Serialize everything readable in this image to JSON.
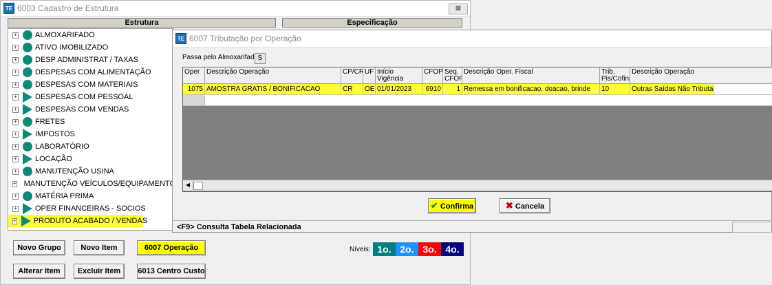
{
  "main_window": {
    "title": "6003 Cadastro de Estrutura",
    "close_label": "⊠",
    "headers": {
      "estrutura": "Estrutura",
      "especificacao": "Especificação"
    },
    "tree_items": [
      {
        "label": "ALMOXARIFADO",
        "icon": "circle"
      },
      {
        "label": "ATIVO IMOBILIZADO",
        "icon": "circle"
      },
      {
        "label": "DESP ADMINISTRAT / TAXAS",
        "icon": "circle"
      },
      {
        "label": "DESPESAS COM ALIMENTAÇÃO",
        "icon": "circle"
      },
      {
        "label": "DESPESAS COM MATERIAIS",
        "icon": "circle"
      },
      {
        "label": "DESPESAS COM PESSOAL",
        "icon": "triangle"
      },
      {
        "label": "DESPESAS COM VENDAS",
        "icon": "triangle"
      },
      {
        "label": "FRETES",
        "icon": "circle"
      },
      {
        "label": "IMPOSTOS",
        "icon": "triangle"
      },
      {
        "label": "LABORATÓRIO",
        "icon": "circle"
      },
      {
        "label": "LOCAÇÃO",
        "icon": "triangle"
      },
      {
        "label": "MANUTENÇÃO USINA",
        "icon": "circle"
      },
      {
        "label": "MANUTENÇÃO VEÍCULOS/EQUIPAMENTOS",
        "icon": "circle"
      },
      {
        "label": "MATÉRIA PRIMA",
        "icon": "circle"
      },
      {
        "label": "OPER FINANCEIRAS - SOCIOS",
        "icon": "triangle"
      },
      {
        "label": "PRODUTO ACABADO / VENDAS",
        "icon": "triangle"
      }
    ],
    "buttons": {
      "novo_grupo": "Novo Grupo",
      "novo_item": "Novo Item",
      "operacao": "6007 Operação",
      "alterar_item": "Alterar Item",
      "excluir_item": "Excluir Item",
      "centro_custo": "6013 Centro Custo"
    },
    "niveis": {
      "label": "Níveis:",
      "levels": [
        {
          "label": "1o.",
          "color": "#008080"
        },
        {
          "label": "2o.",
          "color": "#1e90ff"
        },
        {
          "label": "3o.",
          "color": "#ff0000"
        },
        {
          "label": "4o.",
          "color": "#000080"
        }
      ]
    }
  },
  "dialog": {
    "title": "6007 Tributação por Operação",
    "passa_label": "Passa pelo Almoxarifado:",
    "passa_value": "S",
    "columns": [
      "Oper",
      "Descrição Operação",
      "CP/CR",
      "UF",
      "Início Vigência",
      "CFOP",
      "Seq. CFOP",
      "Descrição Oper. Fiscal",
      "Trib. Pis/Cofins",
      "Descrição Operação"
    ],
    "row": {
      "oper": "1075",
      "descricao": "AMOSTRA GRATIS / BONIFICACAO",
      "cpcr": "CR",
      "uf": "OE",
      "inicio": "01/01/2023",
      "cfop": "6910",
      "seq": "1",
      "desc_fiscal": "Remessa em bonificacao, doacao, brinde",
      "trib": "10",
      "desc_op2": "Outras Saídas Não Tributadas"
    },
    "buttons": {
      "confirma": "Confirma",
      "cancela": "Cancela"
    },
    "status": "<F9> Consulta Tabela Relacionada"
  },
  "colors": {
    "highlight": "#ffff33",
    "tree_icon": "#0f8a7a"
  }
}
